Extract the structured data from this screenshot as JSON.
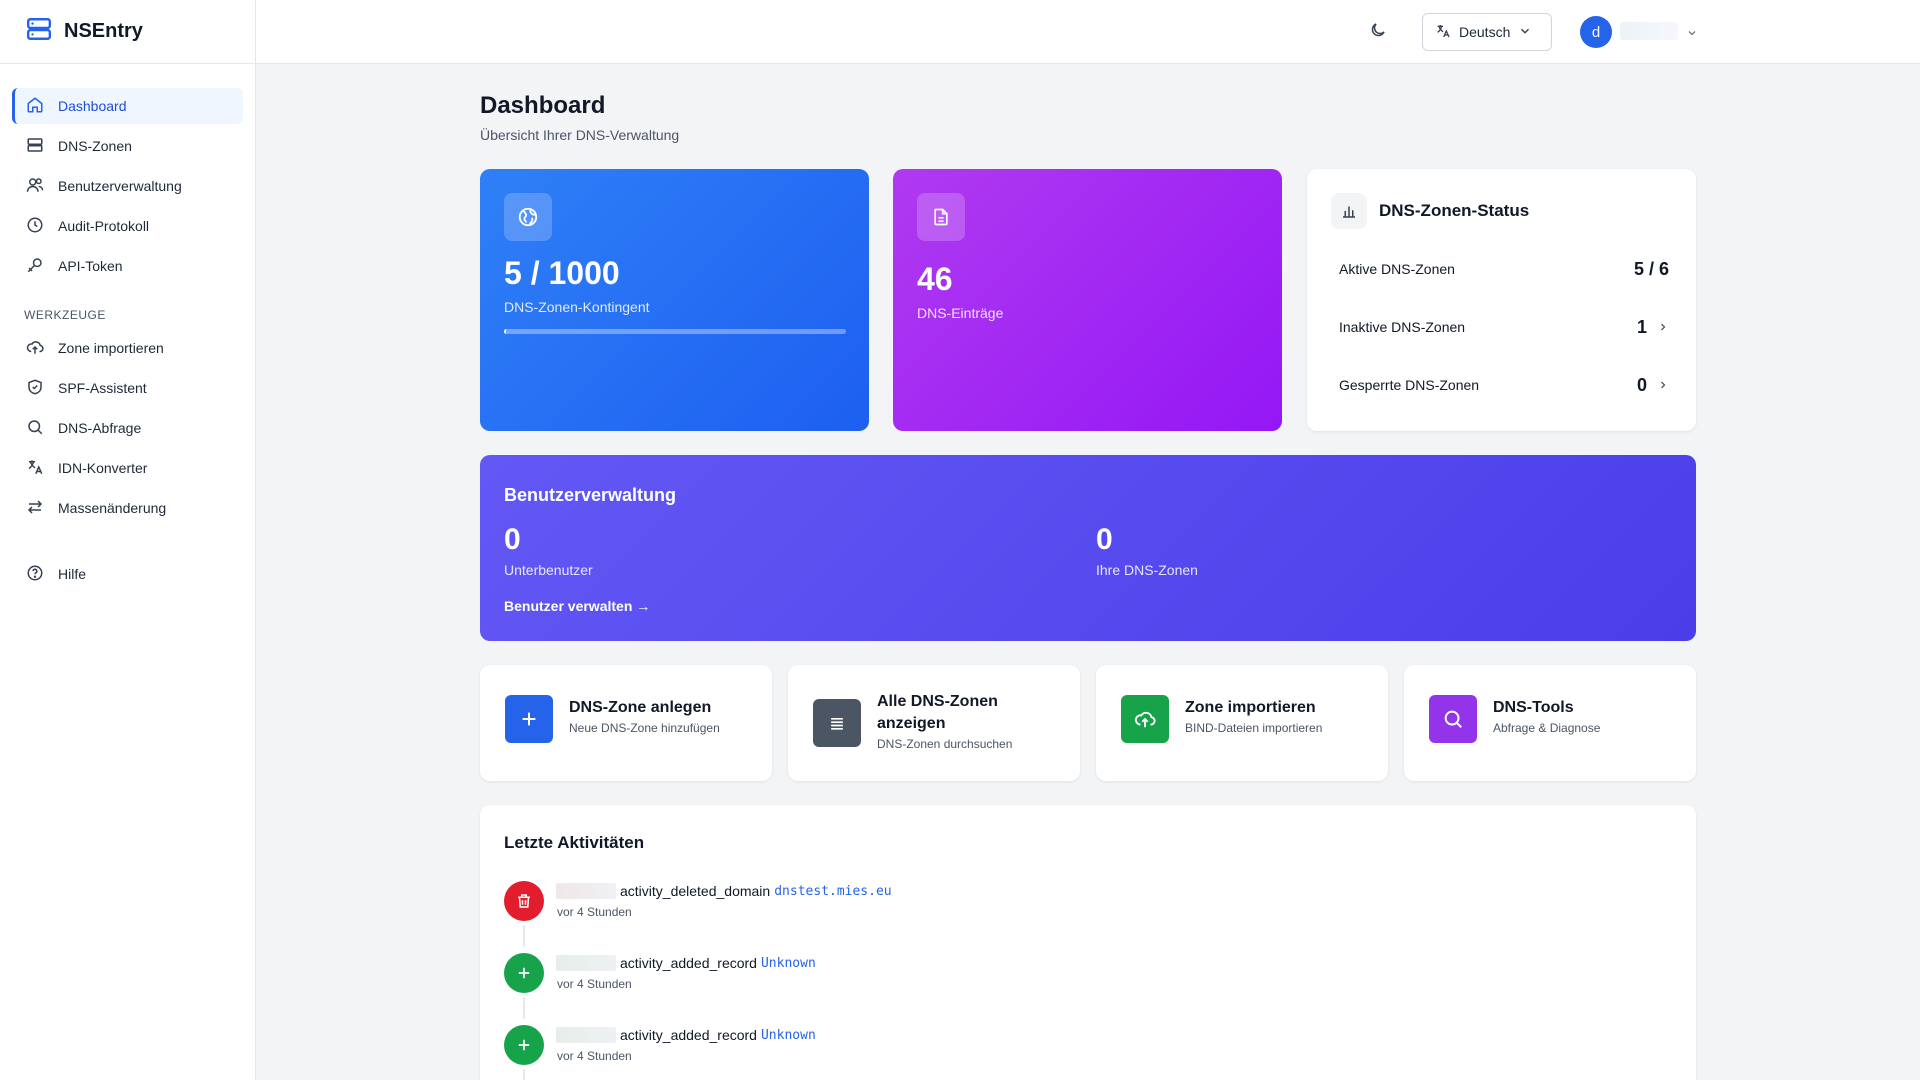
{
  "app": {
    "name": "NSEntry"
  },
  "sidebar": {
    "items": [
      {
        "label": "Dashboard"
      },
      {
        "label": "DNS-Zonen"
      },
      {
        "label": "Benutzerverwaltung"
      },
      {
        "label": "Audit-Protokoll"
      },
      {
        "label": "API-Token"
      }
    ],
    "tools_section": "WERKZEUGE",
    "tools": [
      {
        "label": "Zone importieren"
      },
      {
        "label": "SPF-Assistent"
      },
      {
        "label": "DNS-Abfrage"
      },
      {
        "label": "IDN-Konverter"
      },
      {
        "label": "Massenänderung"
      }
    ],
    "help": {
      "label": "Hilfe"
    }
  },
  "topbar": {
    "language": "Deutsch",
    "avatar_initial": "d"
  },
  "page": {
    "title": "Dashboard",
    "subtitle": "Übersicht Ihrer DNS-Verwaltung"
  },
  "stats": {
    "quota": {
      "value": "5 / 1000",
      "label": "DNS-Zonen-Kontingent",
      "progress": 0.005
    },
    "records": {
      "value": "46",
      "label": "DNS-Einträge"
    }
  },
  "zone_status": {
    "title": "DNS-Zonen-Status",
    "rows": [
      {
        "label": "Aktive DNS-Zonen",
        "value": "5 / 6"
      },
      {
        "label": "Inaktive DNS-Zonen",
        "value": "1"
      },
      {
        "label": "Gesperrte DNS-Zonen",
        "value": "0"
      }
    ]
  },
  "user_mgmt": {
    "title": "Benutzerverwaltung",
    "subusers_value": "0",
    "subusers_label": "Unterbenutzer",
    "zones_value": "0",
    "zones_label": "Ihre DNS-Zonen",
    "link": "Benutzer verwalten →"
  },
  "actions": [
    {
      "title": "DNS-Zone anlegen",
      "subtitle": "Neue DNS-Zone hinzufügen",
      "color": "#2563eb"
    },
    {
      "title": "Alle DNS-Zonen anzeigen",
      "subtitle": "DNS-Zonen durchsuchen",
      "color": "#4b5563"
    },
    {
      "title": "Zone importieren",
      "subtitle": "BIND-Dateien importieren",
      "color": "#16a34a"
    },
    {
      "title": "DNS-Tools",
      "subtitle": "Abfrage & Diagnose",
      "color": "#9333ea"
    }
  ],
  "activity": {
    "title": "Letzte Aktivitäten",
    "items": [
      {
        "action": "activity_deleted_domain",
        "target": "dnstest.mies.eu",
        "time": "vor 4 Stunden",
        "color": "#e11d2e"
      },
      {
        "action": "activity_added_record",
        "target": "Unknown",
        "time": "vor 4 Stunden",
        "color": "#16a34a"
      },
      {
        "action": "activity_added_record",
        "target": "Unknown",
        "time": "vor 4 Stunden",
        "color": "#16a34a"
      }
    ]
  },
  "colors": {
    "accent": "#2563eb",
    "quota_card": "#1d5ff0",
    "records_card": "#9417f5",
    "users_card": "#4a3ee9"
  }
}
